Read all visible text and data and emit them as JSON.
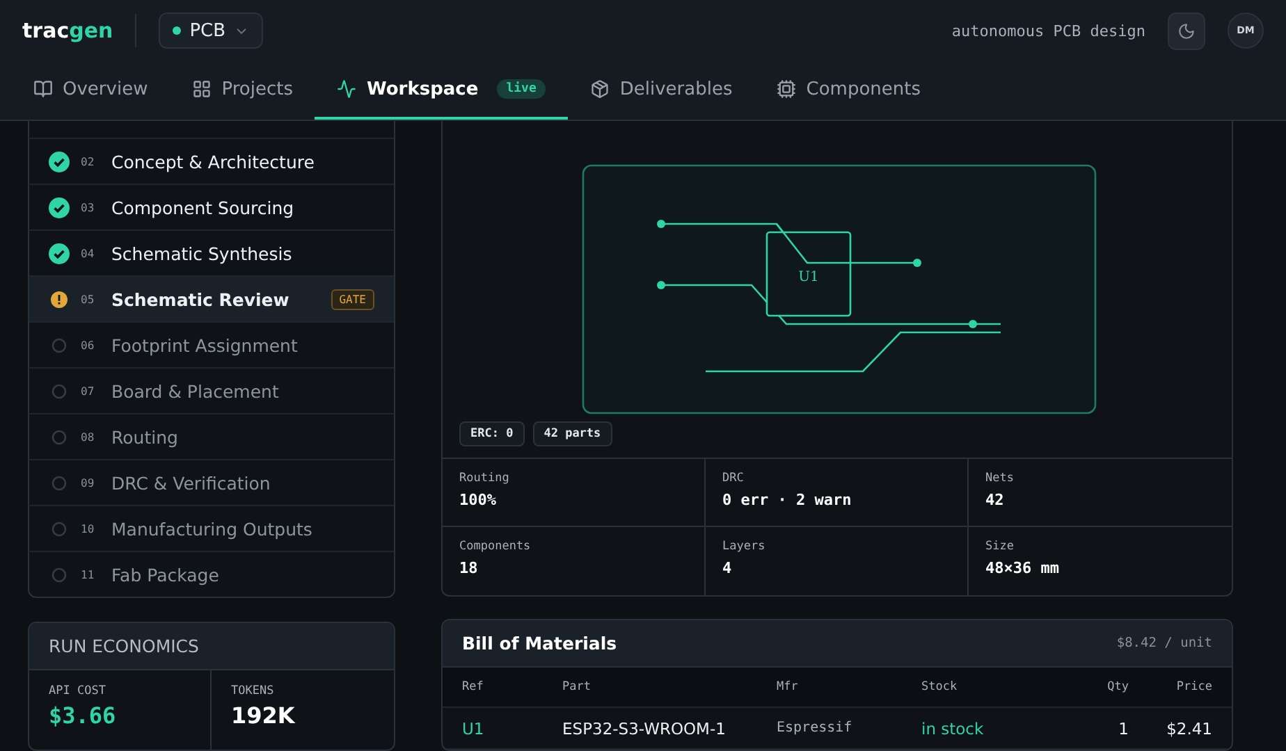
{
  "brand": {
    "main": "trac",
    "accent": "gen"
  },
  "project_select": {
    "label": "PCB"
  },
  "tagline": "autonomous PCB design",
  "avatar": "DM",
  "tabs": [
    {
      "label": "Overview",
      "kind": "book",
      "selected": false
    },
    {
      "label": "Projects",
      "kind": "grid",
      "selected": false
    },
    {
      "label": "Workspace",
      "kind": "activity",
      "selected": true,
      "badge": "live"
    },
    {
      "label": "Deliverables",
      "kind": "package",
      "selected": false
    },
    {
      "label": "Components",
      "kind": "cpu",
      "selected": false
    }
  ],
  "steps": [
    {
      "num": "02",
      "label": "Concept & Architecture",
      "kind": "done",
      "selected": false
    },
    {
      "num": "03",
      "label": "Component Sourcing",
      "kind": "done",
      "selected": false
    },
    {
      "num": "04",
      "label": "Schematic Synthesis",
      "kind": "done",
      "selected": false
    },
    {
      "num": "05",
      "label": "Schematic Review",
      "kind": "warning",
      "selected": true,
      "badge": "GATE"
    },
    {
      "num": "06",
      "label": "Footprint Assignment",
      "kind": "pending",
      "selected": false
    },
    {
      "num": "07",
      "label": "Board & Placement",
      "kind": "pending",
      "selected": false
    },
    {
      "num": "08",
      "label": "Routing",
      "kind": "pending",
      "selected": false
    },
    {
      "num": "09",
      "label": "DRC & Verification",
      "kind": "pending",
      "selected": false
    },
    {
      "num": "10",
      "label": "Manufacturing Outputs",
      "kind": "pending",
      "selected": false
    },
    {
      "num": "11",
      "label": "Fab Package",
      "kind": "pending",
      "selected": false
    }
  ],
  "economics": {
    "title": "RUN ECONOMICS",
    "metrics": [
      {
        "label": "API COST",
        "value": "$3.66",
        "accent": true
      },
      {
        "label": "TOKENS",
        "value": "192K",
        "accent": false
      }
    ]
  },
  "schematic": {
    "part_label": "U1",
    "badges": [
      "ERC: 0",
      "42 parts"
    ]
  },
  "stats": [
    {
      "label": "Routing",
      "value": "100%"
    },
    {
      "label": "DRC",
      "value": "0 err · 2 warn"
    },
    {
      "label": "Nets",
      "value": "42"
    },
    {
      "label": "Components",
      "value": "18"
    },
    {
      "label": "Layers",
      "value": "4"
    },
    {
      "label": "Size",
      "value": "48×36 mm"
    }
  ],
  "bom": {
    "title": "Bill of Materials",
    "unit_price": "$8.42 / unit",
    "columns": [
      "Ref",
      "Part",
      "Mfr",
      "Stock",
      "Qty",
      "Price"
    ],
    "rows": [
      {
        "ref": "U1",
        "part": "ESP32-S3-WROOM-1",
        "mfr": "Espressif",
        "stock": "in stock",
        "qty": "1",
        "price": "$2.41"
      }
    ]
  }
}
